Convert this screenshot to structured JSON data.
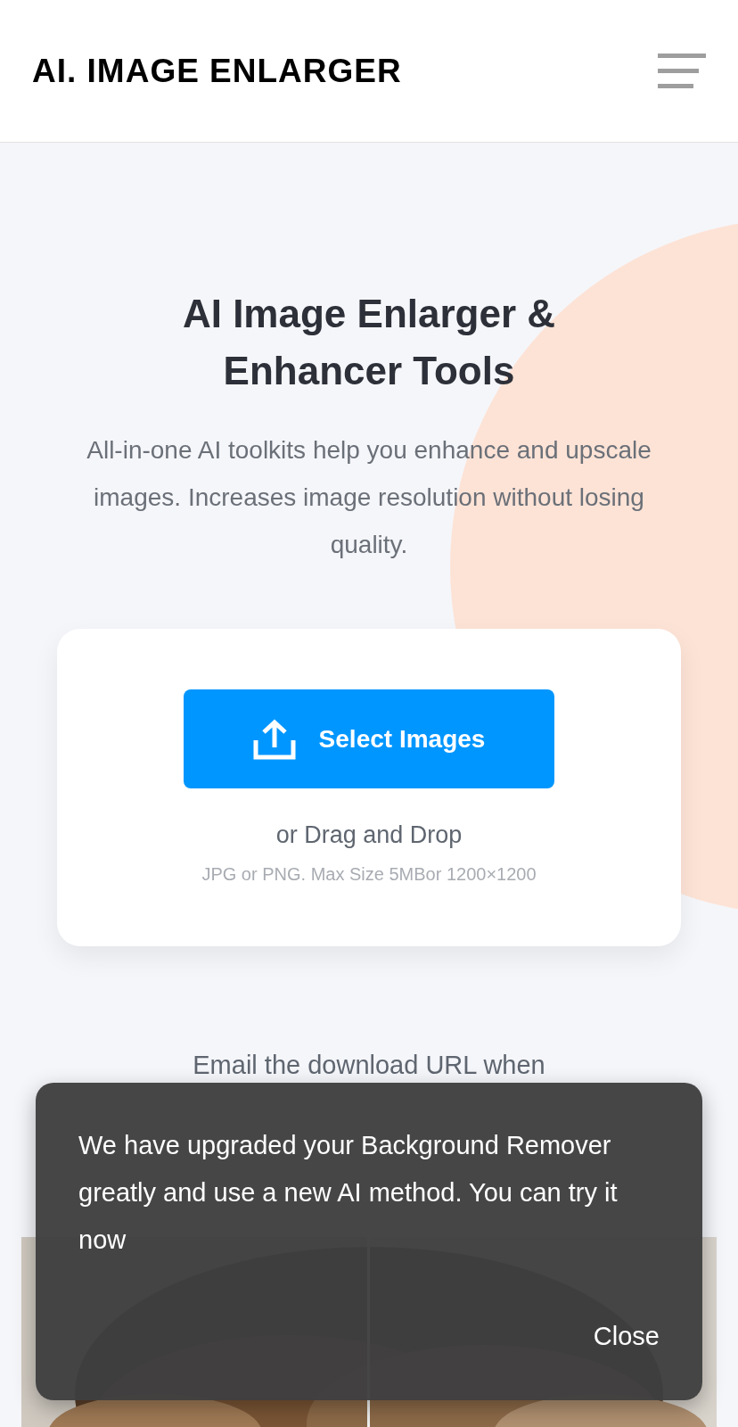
{
  "header": {
    "logo": "AI. IMAGE ENLARGER"
  },
  "hero": {
    "title": "AI Image Enlarger & Enhancer Tools",
    "subtitle": "All-in-one AI toolkits help you enhance and upscale images. Increases image resolution without losing quality."
  },
  "upload": {
    "button": "Select Images",
    "drag_hint": "or Drag and Drop",
    "limits": "JPG or PNG. Max Size 5MBor 1200×1200"
  },
  "email_option": {
    "label": "Email the download URL when"
  },
  "toast": {
    "message": "We have upgraded your Background Remover greatly and use a new AI method. You can try it now",
    "close": "Close"
  }
}
